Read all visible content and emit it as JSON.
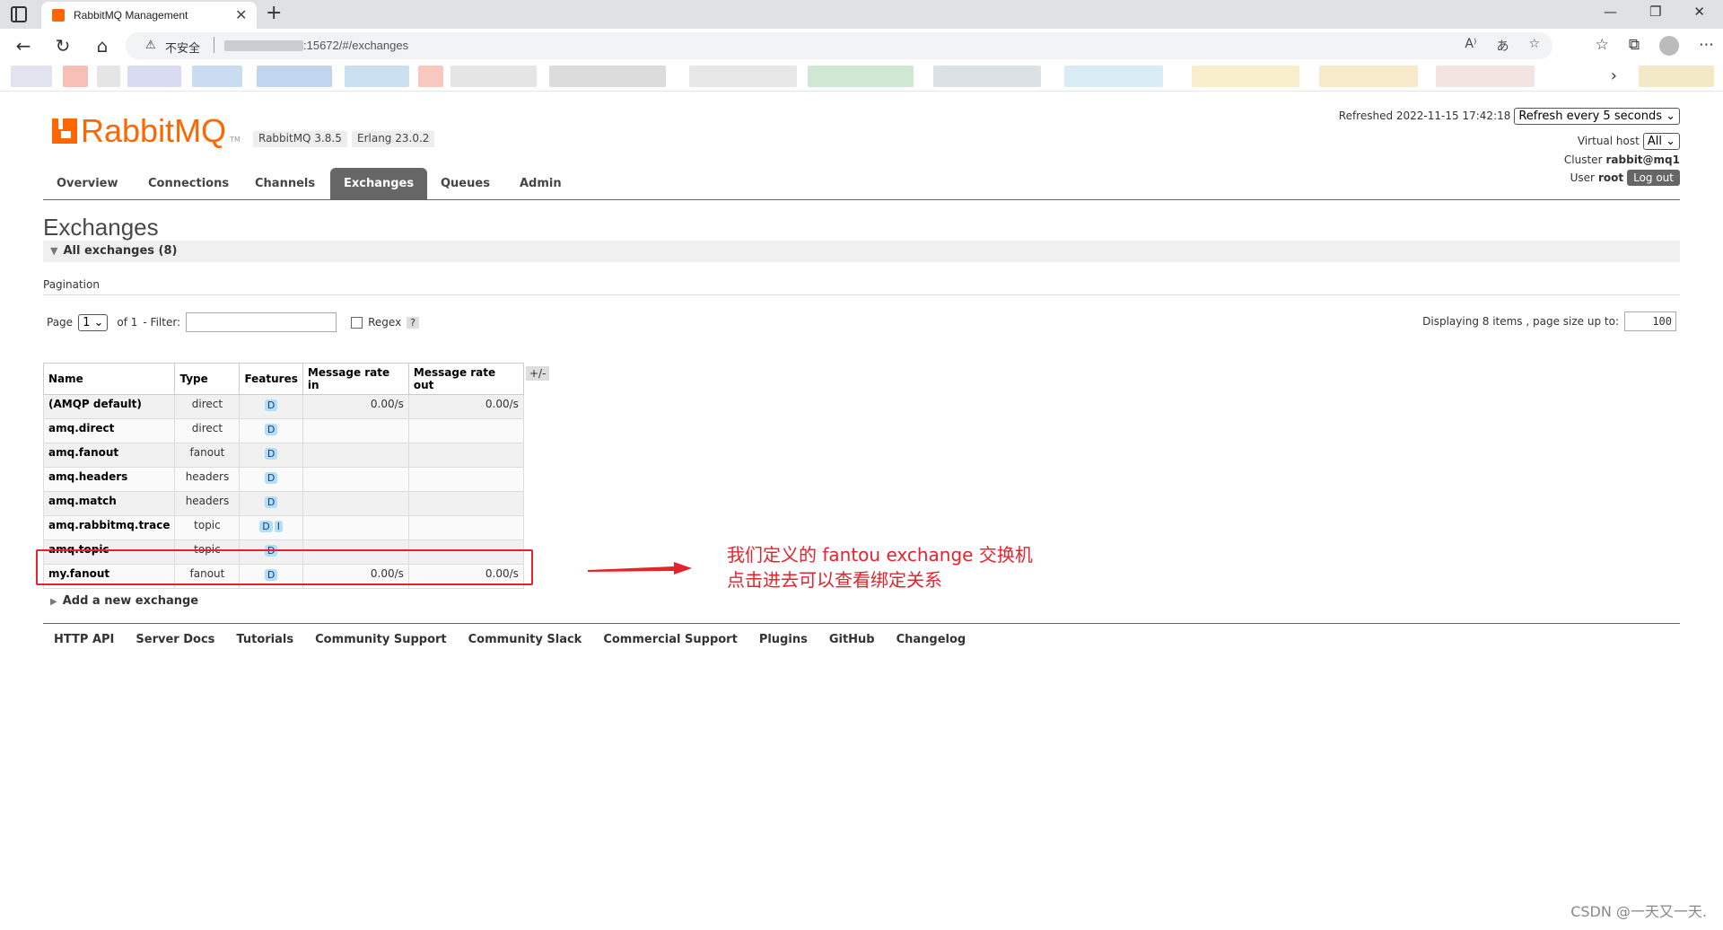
{
  "browser": {
    "tab_title": "RabbitMQ Management",
    "tab_close": "✕",
    "new_tab": "+",
    "insecure_label": "不安全",
    "url": ":15672/#/exchanges",
    "window_controls": [
      "—",
      "❐",
      "✕"
    ]
  },
  "app": {
    "logo_text": "RabbitMQ",
    "logo_tm": "TM",
    "version": "RabbitMQ 3.8.5",
    "erlang": "Erlang 23.0.2",
    "refreshed": "Refreshed 2022-11-15 17:42:18",
    "refresh_select": "Refresh every 5 seconds",
    "virtual_host_label": "Virtual host",
    "virtual_host_value": "All",
    "cluster_label": "Cluster",
    "cluster_value": "rabbit@mq1",
    "user_label": "User",
    "user_value": "root",
    "logout": "Log out"
  },
  "nav": [
    "Overview",
    "Connections",
    "Channels",
    "Exchanges",
    "Queues",
    "Admin"
  ],
  "page": {
    "title": "Exchanges",
    "section": "All exchanges (8)",
    "pagination_label": "Pagination",
    "page_label": "Page",
    "page_value": "1",
    "of_label": "of 1",
    "filter_label": "- Filter:",
    "regex_label": "Regex",
    "help": "?",
    "displaying": "Displaying 8 items , page size up to:",
    "page_size": "100",
    "plus_minus": "+/-",
    "add_new": "Add a new exchange"
  },
  "table": {
    "headers": [
      "Name",
      "Type",
      "Features",
      "Message rate in",
      "Message rate out"
    ],
    "rows": [
      {
        "name": "(AMQP default)",
        "type": "direct",
        "features": [
          "D"
        ],
        "rate_in": "0.00/s",
        "rate_out": "0.00/s"
      },
      {
        "name": "amq.direct",
        "type": "direct",
        "features": [
          "D"
        ],
        "rate_in": "",
        "rate_out": ""
      },
      {
        "name": "amq.fanout",
        "type": "fanout",
        "features": [
          "D"
        ],
        "rate_in": "",
        "rate_out": ""
      },
      {
        "name": "amq.headers",
        "type": "headers",
        "features": [
          "D"
        ],
        "rate_in": "",
        "rate_out": ""
      },
      {
        "name": "amq.match",
        "type": "headers",
        "features": [
          "D"
        ],
        "rate_in": "",
        "rate_out": ""
      },
      {
        "name": "amq.rabbitmq.trace",
        "type": "topic",
        "features": [
          "D",
          "I"
        ],
        "rate_in": "",
        "rate_out": ""
      },
      {
        "name": "amq.topic",
        "type": "topic",
        "features": [
          "D"
        ],
        "rate_in": "",
        "rate_out": ""
      },
      {
        "name": "my.fanout",
        "type": "fanout",
        "features": [
          "D"
        ],
        "rate_in": "0.00/s",
        "rate_out": "0.00/s"
      }
    ]
  },
  "footer": [
    "HTTP API",
    "Server Docs",
    "Tutorials",
    "Community Support",
    "Community Slack",
    "Commercial Support",
    "Plugins",
    "GitHub",
    "Changelog"
  ],
  "annotation": {
    "line1": "我们定义的 fantou exchange 交换机",
    "line2": "点击进去可以查看绑定关系",
    "color": "#e5232d"
  },
  "watermark": "CSDN @一天又一天."
}
